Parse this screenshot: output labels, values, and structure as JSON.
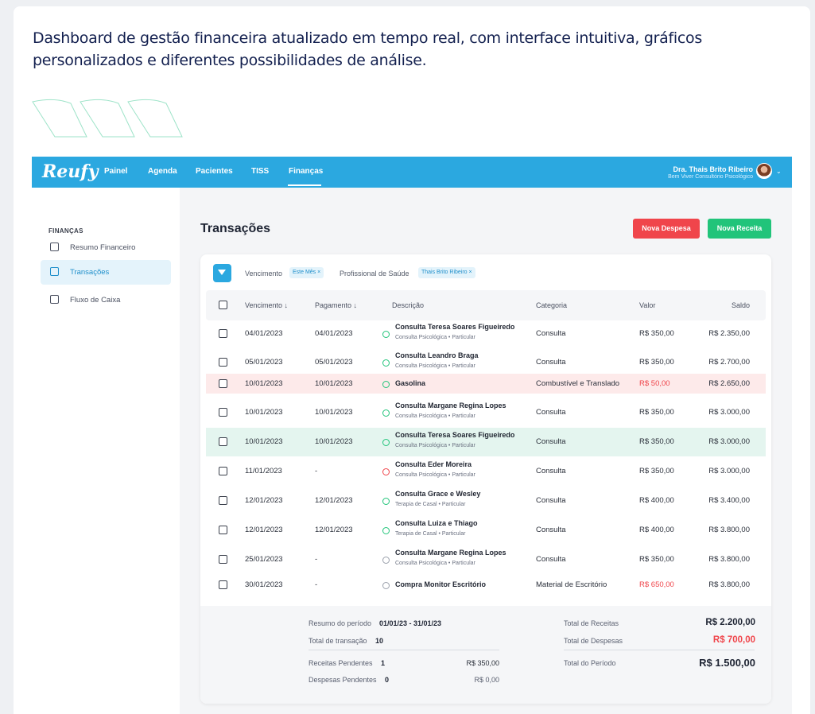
{
  "intro": "Dashboard de gestão financeira atualizado em tempo real, com interface intuitiva, gráficos personalizados e diferentes possibilidades de análise.",
  "colors": {
    "primary": "#2ba8e0",
    "danger": "#f0454b",
    "success": "#21c47a"
  },
  "topbar": {
    "logo": "Reufy",
    "nav": [
      "Painel",
      "Agenda",
      "Pacientes",
      "TISS",
      "Finanças"
    ],
    "active_nav": "Finanças",
    "user_name": "Dra. Thais Brito Ribeiro",
    "user_org": "Bem Viver Consultório Psicológico"
  },
  "sidebar": {
    "title": "FINANÇAS",
    "items": [
      {
        "label": "Resumo Financeiro",
        "icon": "chart-icon"
      },
      {
        "label": "Transações",
        "icon": "transfer-icon",
        "active": true
      },
      {
        "label": "Fluxo de Caixa",
        "icon": "cashflow-icon"
      }
    ]
  },
  "main": {
    "title": "Transações",
    "btn_expense": "Nova Despesa",
    "btn_income": "Nova Receita"
  },
  "filters": {
    "f1_label": "Vencimento",
    "f1_chip": "Este Mês ×",
    "f2_label": "Profissional de Saúde",
    "f2_chip": "Thais Brito Ribeiro ×"
  },
  "table": {
    "headers": [
      "Vencimento ↓",
      "Pagamento ↓",
      "Descrição",
      "Categoria",
      "Valor",
      "Saldo"
    ],
    "rows": [
      {
        "venc": "04/01/2023",
        "pag": "04/01/2023",
        "status": "ok",
        "title": "Consulta Teresa Soares Figueiredo",
        "sub": "Consulta Psicológica • Particular",
        "cat": "Consulta",
        "valor": "R$ 350,00",
        "saldo": "R$ 2.350,00"
      },
      {
        "venc": "05/01/2023",
        "pag": "05/01/2023",
        "status": "ok",
        "title": "Consulta Leandro Braga",
        "sub": "Consulta Psicológica • Particular",
        "cat": "Consulta",
        "valor": "R$ 350,00",
        "saldo": "R$ 2.700,00"
      },
      {
        "venc": "10/01/2023",
        "pag": "10/01/2023",
        "status": "ok",
        "title": "Gasolina",
        "sub": "",
        "cat": "Combustível e Translado",
        "valor": "R$ 50,00",
        "saldo": "R$ 2.650,00",
        "neg": true,
        "hl": "red"
      },
      {
        "venc": "10/01/2023",
        "pag": "10/01/2023",
        "status": "ok",
        "title": "Consulta Margane Regina Lopes",
        "sub": "Consulta Psicológica • Particular",
        "cat": "Consulta",
        "valor": "R$ 350,00",
        "saldo": "R$ 3.000,00"
      },
      {
        "venc": "10/01/2023",
        "pag": "10/01/2023",
        "status": "ok",
        "title": "Consulta Teresa Soares Figueiredo",
        "sub": "Consulta Psicológica • Particular",
        "cat": "Consulta",
        "valor": "R$ 350,00",
        "saldo": "R$ 3.000,00",
        "hl": "green"
      },
      {
        "venc": "11/01/2023",
        "pag": "-",
        "status": "err",
        "title": "Consulta Eder Moreira",
        "sub": "Consulta Psicológica • Particular",
        "cat": "Consulta",
        "valor": "R$ 350,00",
        "saldo": "R$ 3.000,00"
      },
      {
        "venc": "12/01/2023",
        "pag": "12/01/2023",
        "status": "ok",
        "title": "Consulta Grace e Wesley",
        "sub": "Terapia de Casal • Particular",
        "cat": "Consulta",
        "valor": "R$ 400,00",
        "saldo": "R$ 3.400,00"
      },
      {
        "venc": "12/01/2023",
        "pag": "12/01/2023",
        "status": "ok",
        "title": "Consulta Luiza e Thiago",
        "sub": "Terapia de Casal • Particular",
        "cat": "Consulta",
        "valor": "R$ 400,00",
        "saldo": "R$ 3.800,00"
      },
      {
        "venc": "25/01/2023",
        "pag": "-",
        "status": "pend",
        "title": "Consulta Margane Regina Lopes",
        "sub": "Consulta Psicológica • Particular",
        "cat": "Consulta",
        "valor": "R$ 350,00",
        "saldo": "R$ 3.800,00"
      },
      {
        "venc": "30/01/2023",
        "pag": "-",
        "status": "pend",
        "title": "Compra Monitor Escritório",
        "sub": "",
        "cat": "Material de Escritório",
        "valor": "R$ 650,00",
        "saldo": "R$ 3.800,00",
        "neg": true
      }
    ]
  },
  "summary": {
    "periodo_label": "Resumo do período",
    "periodo_value": "01/01/23 - 31/01/23",
    "total_trans_label": "Total de transação",
    "total_trans_value": "10",
    "rec_pend_label": "Receitas Pendentes",
    "rec_pend_count": "1",
    "rec_pend_value": "R$ 350,00",
    "desp_pend_label": "Despesas Pendentes",
    "desp_pend_count": "0",
    "desp_pend_value": "R$ 0,00",
    "total_rec_label": "Total de Receitas",
    "total_rec_value": "R$ 2.200,00",
    "total_desp_label": "Total de Despesas",
    "total_desp_value": "R$ 700,00",
    "total_per_label": "Total do Período",
    "total_per_value": "R$ 1.500,00"
  }
}
